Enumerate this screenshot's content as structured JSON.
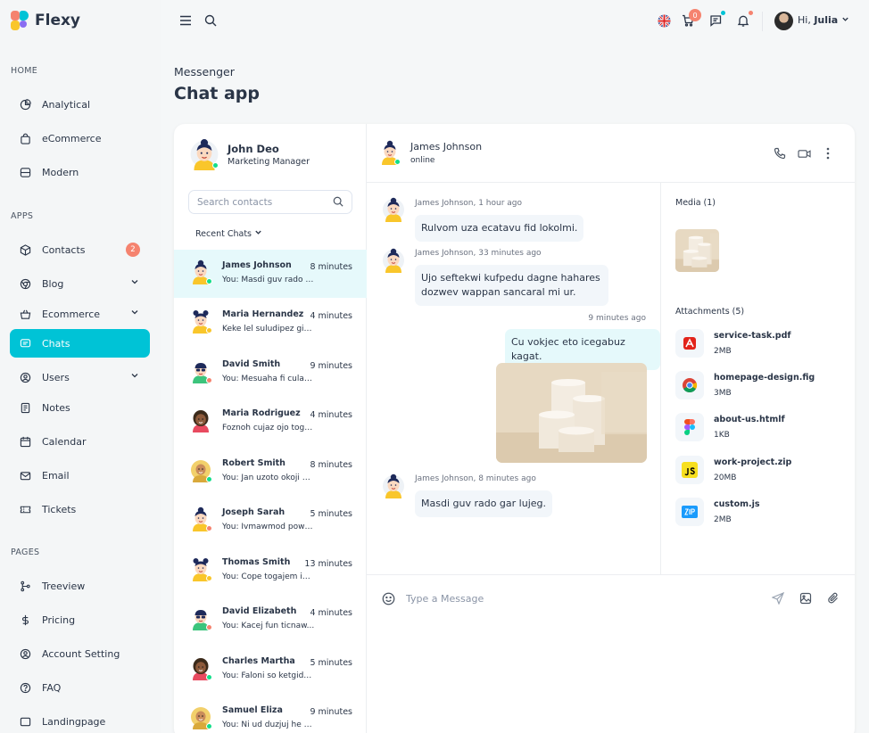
{
  "app": {
    "name": "Flexy"
  },
  "sidebar": {
    "sections": {
      "home": "HOME",
      "apps": "APPS",
      "pages": "PAGES"
    },
    "items": [
      {
        "label": "Analytical"
      },
      {
        "label": "eCommerce"
      },
      {
        "label": "Modern"
      },
      {
        "label": "Contacts",
        "badge": "2"
      },
      {
        "label": "Blog"
      },
      {
        "label": "Ecommerce"
      },
      {
        "label": "Chats"
      },
      {
        "label": "Users"
      },
      {
        "label": "Notes"
      },
      {
        "label": "Calendar"
      },
      {
        "label": "Email"
      },
      {
        "label": "Tickets"
      },
      {
        "label": "Treeview"
      },
      {
        "label": "Pricing"
      },
      {
        "label": "Account Setting"
      },
      {
        "label": "FAQ"
      },
      {
        "label": "Landingpage"
      }
    ]
  },
  "topbar": {
    "cart_count": "0",
    "greeting": "Hi,",
    "user_name": "Julia"
  },
  "page": {
    "breadcrumb": "Messenger",
    "title": "Chat app"
  },
  "me": {
    "name": "John Deo",
    "role": "Marketing Manager"
  },
  "search": {
    "placeholder": "Search contacts"
  },
  "recent_label": "Recent Chats",
  "contacts": [
    {
      "name": "James Johnson",
      "time": "8 minutes",
      "msg": "You: Masdi guv rado gar lujeg."
    },
    {
      "name": "Maria Hernandez",
      "time": "4 minutes",
      "msg": "Keke lel suludipez gisa..."
    },
    {
      "name": "David Smith",
      "time": "9 minutes",
      "msg": "You: Mesuaha fi culap..."
    },
    {
      "name": "Maria Rodriguez",
      "time": "4 minutes",
      "msg": "Foznoh cujaz ojo toga..."
    },
    {
      "name": "Robert Smith",
      "time": "8 minutes",
      "msg": "You: Jan uzoto okoji m..."
    },
    {
      "name": "Joseph Sarah",
      "time": "5 minutes",
      "msg": "You: Ivmawmod powo..."
    },
    {
      "name": "Thomas Smith",
      "time": "13 minutes",
      "msg": "You: Cope togajem in..."
    },
    {
      "name": "David Elizabeth",
      "time": "4 minutes",
      "msg": "You: Kacej fun ticnaw..."
    },
    {
      "name": "Charles Martha",
      "time": "5 minutes",
      "msg": "You: Faloni so ketgidu..."
    },
    {
      "name": "Samuel Eliza",
      "time": "9 minutes",
      "msg": "You: Ni ud duzjuj he g..."
    }
  ],
  "chat": {
    "contact_name": "James Johnson",
    "status": "online",
    "messages": [
      {
        "meta": "James Johnson, 1 hour ago",
        "text": "Rulvom uza ecatavu fid lokolmi."
      },
      {
        "meta": "James Johnson, 33 minutes ago",
        "text": "Ujo seftekwi kufpedu dagne hahares dozwev wappan sancaral mi ur."
      },
      {
        "meta": "9 minutes ago",
        "text": "Cu vokjec eto icegabuz kagat."
      },
      {
        "meta": "James Johnson, 8 minutes ago",
        "text": "Masdi guv rado gar lujeg."
      }
    ],
    "composer_placeholder": "Type a Message"
  },
  "media": {
    "title": "Media (1)",
    "attachments_title": "Attachments (5)",
    "attachments": [
      {
        "name": "service-task.pdf",
        "size": "2MB"
      },
      {
        "name": "homepage-design.fig",
        "size": "3MB"
      },
      {
        "name": "about-us.htmlf",
        "size": "1KB"
      },
      {
        "name": "work-project.zip",
        "size": "20MB"
      },
      {
        "name": "custom.js",
        "size": "2MB"
      }
    ]
  },
  "colors": {
    "accent": "#00c3d6",
    "badge": "#f5836f",
    "online": "#13de8a",
    "away": "#f5836f"
  }
}
